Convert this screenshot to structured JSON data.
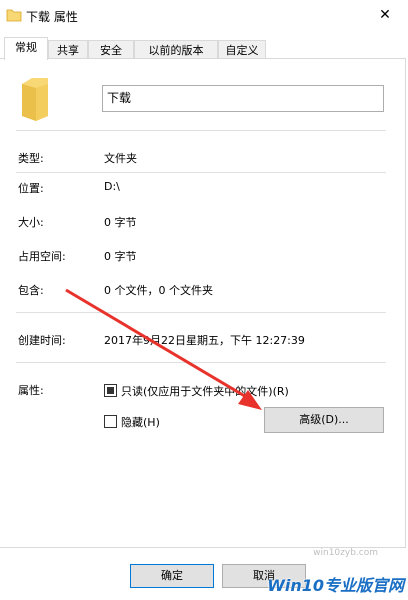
{
  "window": {
    "title": "下载 属性",
    "close_label": "✕"
  },
  "tabs": [
    {
      "label": "常规",
      "active": true
    },
    {
      "label": "共享",
      "active": false
    },
    {
      "label": "安全",
      "active": false
    },
    {
      "label": "以前的版本",
      "active": false
    },
    {
      "label": "自定义",
      "active": false
    }
  ],
  "general": {
    "name_value": "下载",
    "type_label": "类型:",
    "type_value": "文件夹",
    "location_label": "位置:",
    "location_value": "D:\\",
    "size_label": "大小:",
    "size_value": "0 字节",
    "size_on_disk_label": "占用空间:",
    "size_on_disk_value": "0 字节",
    "contains_label": "包含:",
    "contains_value": "0 个文件，0 个文件夹",
    "created_label": "创建时间:",
    "created_value": "2017年9月22日星期五，下午 12:27:39",
    "attributes_label": "属性:",
    "readonly_label": "只读(仅应用于文件夹中的文件)(R)",
    "readonly_checked": true,
    "hidden_label": "隐藏(H)",
    "hidden_checked": false,
    "advanced_button": "高级(D)..."
  },
  "footer": {
    "ok_button": "确定",
    "cancel_button": "取消"
  },
  "watermark": {
    "logo_text": "Win10专业版官网",
    "url": "win10zyb.com"
  },
  "colors": {
    "folder_yellow": "#f8d775",
    "arrow_red": "#e8322c",
    "accent_blue": "#0078d7"
  }
}
